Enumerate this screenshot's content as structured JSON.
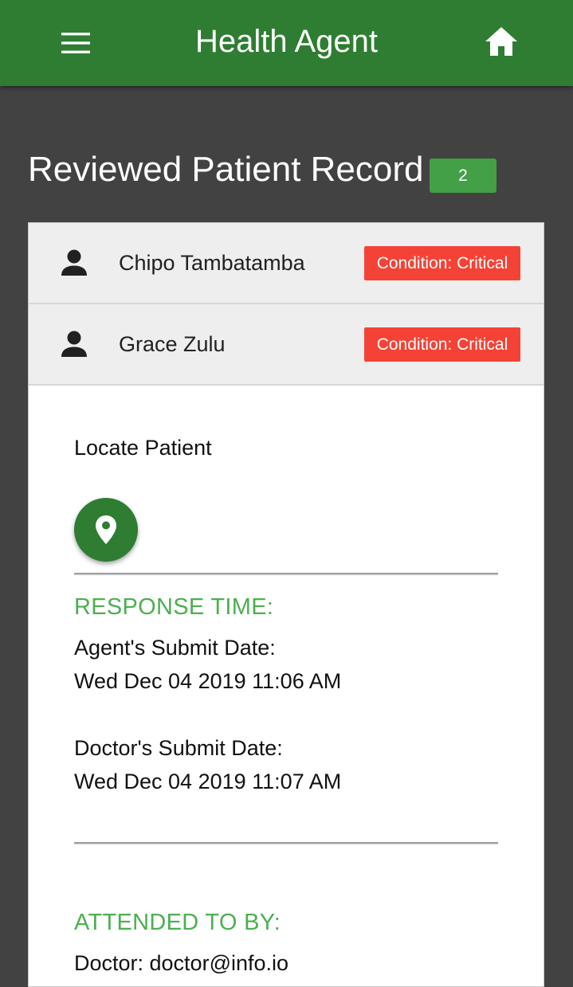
{
  "app_bar": {
    "title": "Health Agent",
    "menu_icon": "menu-icon",
    "home_icon": "home-icon"
  },
  "page": {
    "heading": "Reviewed Patient Record",
    "count": "2"
  },
  "patients": [
    {
      "name": "Chipo Tambatamba",
      "condition": "Condition: Critical",
      "icon": "person-icon"
    },
    {
      "name": "Grace Zulu",
      "condition": "Condition: Critical",
      "icon": "person-icon"
    }
  ],
  "detail": {
    "locate_label": "Locate Patient",
    "locate_icon": "map-pin-icon",
    "response_heading": "RESPONSE TIME:",
    "agent_submit_label": "Agent's Submit Date:",
    "agent_submit_date": "Wed Dec 04 2019 11:06 AM",
    "doctor_submit_label": "Doctor's Submit Date:",
    "doctor_submit_date": "Wed Dec 04 2019 11:07 AM",
    "attended_heading": "ATTENDED TO BY:",
    "attended_by": "Doctor: doctor@info.io"
  },
  "colors": {
    "app_bar": "#2e7d32",
    "background": "#424242",
    "count_badge": "#43a047",
    "critical_badge": "#f44336",
    "section_heading": "#4caf50"
  }
}
